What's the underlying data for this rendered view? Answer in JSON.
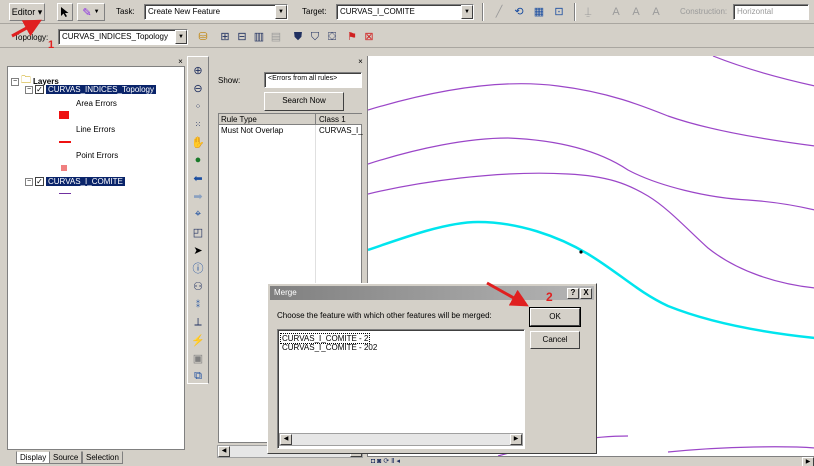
{
  "editor_toolbar": {
    "editor_label": "Editor ▾",
    "task_label": "Task:",
    "task_value": "Create New Feature",
    "target_label": "Target:",
    "target_value": "CURVAS_I_COMITE",
    "construction_label": "Construction:",
    "construction_value": "Horizontal"
  },
  "topology_toolbar": {
    "topology_label": "Topology:",
    "topology_value": "CURVAS_INDICES_Topology"
  },
  "toc": {
    "root_label": "Layers",
    "topology_layer": "CURVAS_INDICES_Topology",
    "area_errors": "Area Errors",
    "line_errors": "Line Errors",
    "point_errors": "Point Errors",
    "feature_layer": "CURVAS_I_COMITE",
    "tabs": [
      "Display",
      "Source",
      "Selection"
    ]
  },
  "errors_panel": {
    "show_label": "Show:",
    "show_value": "<Errors from all rules>",
    "search_button": "Search Now",
    "columns": [
      "Rule Type",
      "Class 1"
    ],
    "rows": [
      [
        "Must Not Overlap",
        "CURVAS_I_"
      ]
    ]
  },
  "merge_dialog": {
    "title": "Merge",
    "help_btn": "?",
    "close_btn": "X",
    "prompt": "Choose the feature with which other features will be merged:",
    "features": [
      "CURVAS_I_COMITE - 2",
      "CURVAS_I_COMITE - 202"
    ],
    "ok_label": "OK",
    "cancel_label": "Cancel"
  },
  "annotations": {
    "step1": "1",
    "step2": "2"
  },
  "colors": {
    "contour": "#9b46c8",
    "selected_contour": "#00e5ee",
    "arrow": "#e02020",
    "selection": "#0a246a"
  }
}
